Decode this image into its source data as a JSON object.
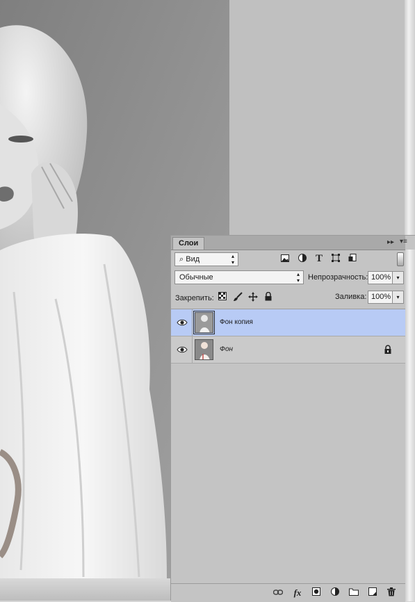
{
  "panel": {
    "tab_label": "Слои",
    "filter": {
      "label": "Вид"
    },
    "blend_mode": "Обычные",
    "opacity_label": "Непрозрачность:",
    "opacity_value": "100%",
    "lock_label": "Закрепить:",
    "fill_label": "Заливка:",
    "fill_value": "100%"
  },
  "filter_icons": [
    "image-filter-icon",
    "adjustment-filter-icon",
    "type-filter-icon",
    "shape-filter-icon",
    "smart-object-filter-icon"
  ],
  "lock_icons": [
    "lock-transparent-icon",
    "lock-image-icon",
    "lock-position-icon",
    "lock-all-icon"
  ],
  "layers": [
    {
      "name": "Фон копия",
      "selected": true,
      "visible": true,
      "locked": false
    },
    {
      "name": "Фон",
      "selected": false,
      "visible": true,
      "locked": true
    }
  ],
  "footer_icons": [
    "link-layers-icon",
    "fx-icon",
    "add-mask-icon",
    "adjustment-layer-icon",
    "new-group-icon",
    "new-layer-icon",
    "delete-layer-icon"
  ],
  "colors": {
    "panel_bg": "#c4c4c4",
    "selected_layer": "#b8cbf5",
    "canvas_bg": "#8f8f8f",
    "pasteboard": "#c0c0c0"
  }
}
